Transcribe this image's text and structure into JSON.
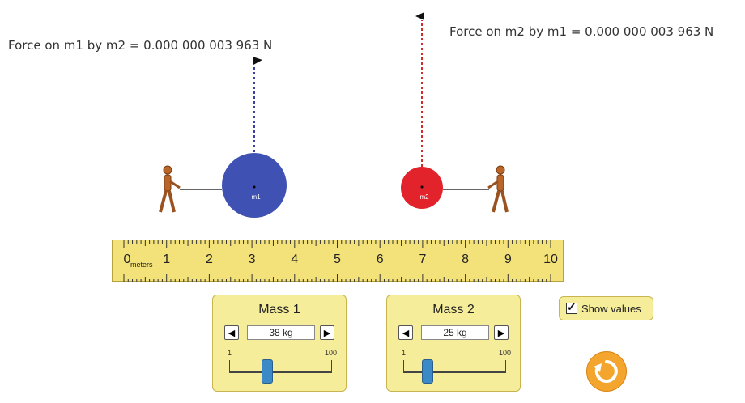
{
  "forces": {
    "on_m1": "Force on m1 by m2 = 0.000 000 003 963 N",
    "on_m2": "Force on m2 by m1 = 0.000 000 003 963 N"
  },
  "masses": {
    "m1_label": "m1",
    "m2_label": "m2",
    "m1_color": "#3f52b3",
    "m2_color": "#e2232b"
  },
  "ruler": {
    "unit": "meters",
    "ticks": [
      "0",
      "1",
      "2",
      "3",
      "4",
      "5",
      "6",
      "7",
      "8",
      "9",
      "10"
    ]
  },
  "mass1": {
    "title": "Mass 1",
    "value": "38 kg",
    "min": "1",
    "max": "100",
    "slider_fraction": 0.37
  },
  "mass2": {
    "title": "Mass 2",
    "value": "25 kg",
    "min": "1",
    "max": "100",
    "slider_fraction": 0.24
  },
  "show_values": {
    "label": "Show values",
    "checked": true
  },
  "icons": {
    "decrement": "◀",
    "increment": "▶",
    "reset": "reset-icon"
  }
}
